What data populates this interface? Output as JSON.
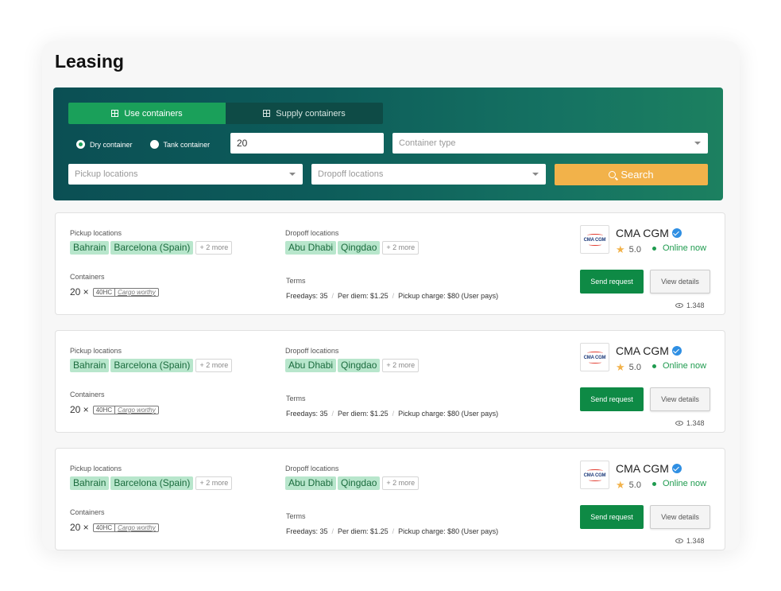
{
  "page": {
    "title": "Leasing"
  },
  "search": {
    "tabs": [
      {
        "label": "Use containers",
        "active": true
      },
      {
        "label": "Supply containers",
        "active": false
      }
    ],
    "radios": [
      {
        "label": "Dry container",
        "checked": true
      },
      {
        "label": "Tank container",
        "checked": false
      }
    ],
    "quantity_value": "20",
    "container_type_placeholder": "Container type",
    "pickup_placeholder": "Pickup locations",
    "dropoff_placeholder": "Dropoff locations",
    "search_label": "Search"
  },
  "listings": [
    {
      "pickup_label": "Pickup locations",
      "pickup_tags": [
        "Bahrain",
        "Barcelona (Spain)"
      ],
      "pickup_more": "+ 2 more",
      "dropoff_label": "Dropoff locations",
      "dropoff_tags": [
        "Abu Dhabi",
        "Qingdao"
      ],
      "dropoff_more": "+ 2 more",
      "containers_label": "Containers",
      "containers_qty": "20 ×",
      "container_code": "40HC",
      "container_condition": "Cargo worthy",
      "terms_label": "Terms",
      "terms": [
        "Freedays: 35",
        "Per diem: $1.25",
        "Pickup charge: $80 (User pays)"
      ],
      "company": "CMA CGM",
      "logo_text": "CMA CGM",
      "rating": "5.0",
      "status": "Online now",
      "send_label": "Send request",
      "view_label": "View details",
      "views": "1.348"
    },
    {
      "pickup_label": "Pickup locations",
      "pickup_tags": [
        "Bahrain",
        "Barcelona (Spain)"
      ],
      "pickup_more": "+ 2 more",
      "dropoff_label": "Dropoff locations",
      "dropoff_tags": [
        "Abu Dhabi",
        "Qingdao"
      ],
      "dropoff_more": "+ 2 more",
      "containers_label": "Containers",
      "containers_qty": "20 ×",
      "container_code": "40HC",
      "container_condition": "Cargo worthy",
      "terms_label": "Terms",
      "terms": [
        "Freedays: 35",
        "Per diem: $1.25",
        "Pickup charge: $80 (User pays)"
      ],
      "company": "CMA CGM",
      "logo_text": "CMA CGM",
      "rating": "5.0",
      "status": "Online now",
      "send_label": "Send request",
      "view_label": "View details",
      "views": "1.348"
    },
    {
      "pickup_label": "Pickup locations",
      "pickup_tags": [
        "Bahrain",
        "Barcelona (Spain)"
      ],
      "pickup_more": "+ 2 more",
      "dropoff_label": "Dropoff locations",
      "dropoff_tags": [
        "Abu Dhabi",
        "Qingdao"
      ],
      "dropoff_more": "+ 2 more",
      "containers_label": "Containers",
      "containers_qty": "20 ×",
      "container_code": "40HC",
      "container_condition": "Cargo worthy",
      "terms_label": "Terms",
      "terms": [
        "Freedays: 35",
        "Per diem: $1.25",
        "Pickup charge: $80 (User pays)"
      ],
      "company": "CMA CGM",
      "logo_text": "CMA CGM",
      "rating": "5.0",
      "status": "Online now",
      "send_label": "Send request",
      "view_label": "View details",
      "views": "1.348"
    }
  ],
  "colors": {
    "accent_green": "#1aa05a",
    "button_green": "#0e8a45",
    "search_orange": "#f2b24a",
    "tag_green_bg": "#b8e6cc",
    "verified_blue": "#2f8fe3"
  },
  "icons": [
    "plus-square-icon",
    "search-icon",
    "chevron-down-icon",
    "verified-icon",
    "star-icon",
    "online-dot-icon",
    "eye-icon"
  ]
}
